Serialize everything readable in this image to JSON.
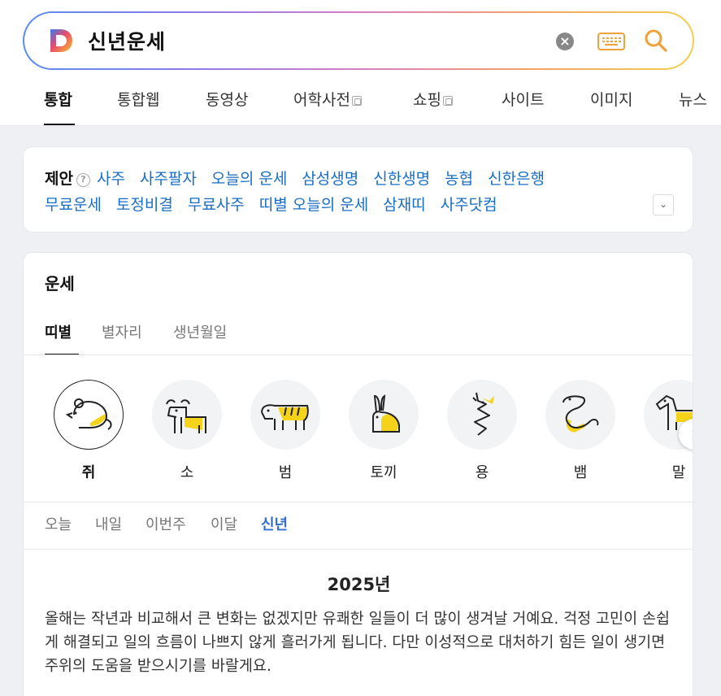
{
  "search": {
    "query": "신년운세",
    "logo_letter": "D"
  },
  "tabs": [
    {
      "label": "통합",
      "external": false
    },
    {
      "label": "통합웹",
      "external": false
    },
    {
      "label": "동영상",
      "external": false
    },
    {
      "label": "어학사전",
      "external": true
    },
    {
      "label": "쇼핑",
      "external": true
    },
    {
      "label": "사이트",
      "external": false
    },
    {
      "label": "이미지",
      "external": false
    },
    {
      "label": "뉴스",
      "external": false
    }
  ],
  "suggestions": {
    "label": "제안",
    "help": "?",
    "row1": [
      "사주",
      "사주팔자",
      "오늘의 운세",
      "삼성생명",
      "신한생명",
      "농협",
      "신한은행"
    ],
    "row2": [
      "무료운세",
      "토정비결",
      "무료사주",
      "띠별 오늘의 운세",
      "삼재띠",
      "사주닷컴"
    ]
  },
  "fortune": {
    "title": "운세",
    "subtabs": [
      "띠별",
      "별자리",
      "생년월일"
    ],
    "zodiac": [
      "쥐",
      "소",
      "범",
      "토끼",
      "용",
      "뱀",
      "말"
    ],
    "periods": [
      "오늘",
      "내일",
      "이번주",
      "이달",
      "신년"
    ],
    "year": "2025년",
    "text": "올해는 작년과 비교해서 큰 변화는 없겠지만 유쾌한 일들이 더 많이 생겨날 거예요. 걱정 고민이 손쉽게 해결되고 일의 흐름이 나쁘지 않게 흘러가게 됩니다. 다만 이성적으로 대처하기 힘든 일이 생기면 주위의 도움을 받으시기를 바랄게요."
  },
  "colors": {
    "link": "#1a6dc4",
    "active_period": "#2e6fd0",
    "zodiac_accent": "#f5d31a"
  }
}
